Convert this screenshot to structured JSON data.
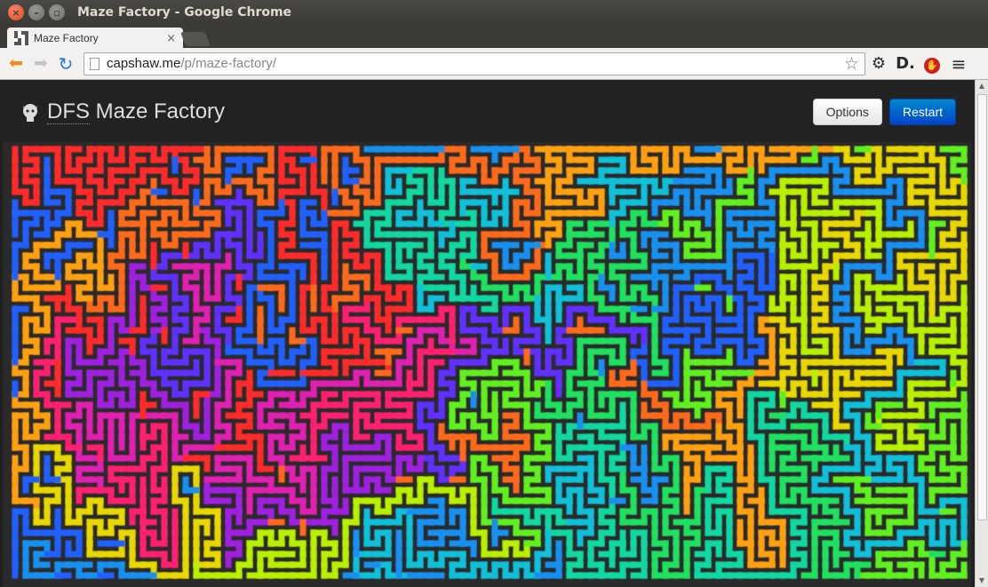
{
  "window": {
    "title": "Maze Factory - Google Chrome",
    "close_glyph": "×",
    "min_glyph": "–",
    "max_glyph": "▫"
  },
  "tab": {
    "label": "Maze Factory",
    "close_glyph": "×"
  },
  "toolbar": {
    "back_glyph": "⬅",
    "forward_glyph": "➡",
    "reload_glyph": "↻",
    "url_host": "capshaw.me",
    "url_path": "/p/maze-factory/",
    "star_glyph": "☆",
    "gear_glyph": "⚙",
    "ext_d_label": "D.",
    "ext_stop_glyph": "✋",
    "menu_glyph": "≡"
  },
  "header": {
    "title_abbr": "DFS",
    "title_rest": " Maze Factory",
    "options_label": "Options",
    "restart_label": "Restart"
  },
  "maze": {
    "palette": [
      "#ff2a2a",
      "#ff6a1a",
      "#ffa010",
      "#e8d800",
      "#b8f000",
      "#60f020",
      "#20e060",
      "#10d8a0",
      "#10c0d8",
      "#1890f0",
      "#2060ff",
      "#6030ff",
      "#a020e0",
      "#e020b0",
      "#ff2070"
    ],
    "background": "#2a2a2a"
  },
  "scrollbar": {
    "up_glyph": "▲",
    "down_glyph": "▼"
  }
}
